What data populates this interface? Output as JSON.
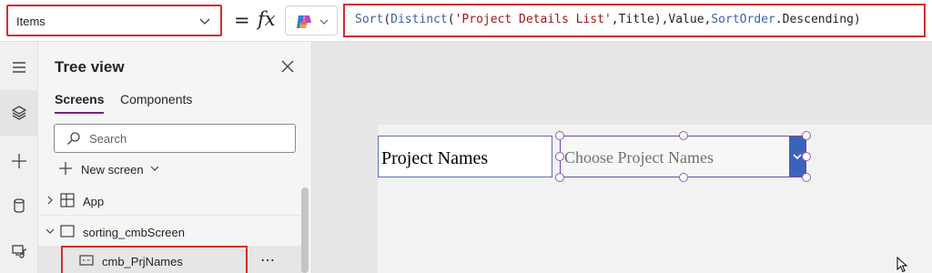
{
  "formula_bar": {
    "property": "Items",
    "equals": "=",
    "fx": "fx",
    "formula": {
      "sort": "Sort",
      "open1": "(",
      "distinct": "Distinct",
      "open2": "(",
      "source": "'Project Details List'",
      "arg1": ",Title),Value,",
      "sortorder": "SortOrder",
      "descending": ".Descending",
      "close": ")"
    }
  },
  "tree_view": {
    "title": "Tree view",
    "tabs": {
      "screens": "Screens",
      "components": "Components"
    },
    "search_placeholder": "Search",
    "new_screen": "New screen",
    "nodes": {
      "app": "App",
      "screen": "sorting_cmbScreen",
      "combobox": "cmb_PrjNames"
    },
    "more": "⋯"
  },
  "canvas": {
    "label_text": "Project Names",
    "combobox_placeholder": "Choose Project Names"
  },
  "colors": {
    "highlight": "#d62c2c",
    "accent": "#742774",
    "dropdown": "#3d63b8"
  },
  "icons": {
    "rail": [
      "hamburger-icon",
      "layers-icon",
      "plus-icon",
      "database-icon",
      "media-icon"
    ]
  }
}
